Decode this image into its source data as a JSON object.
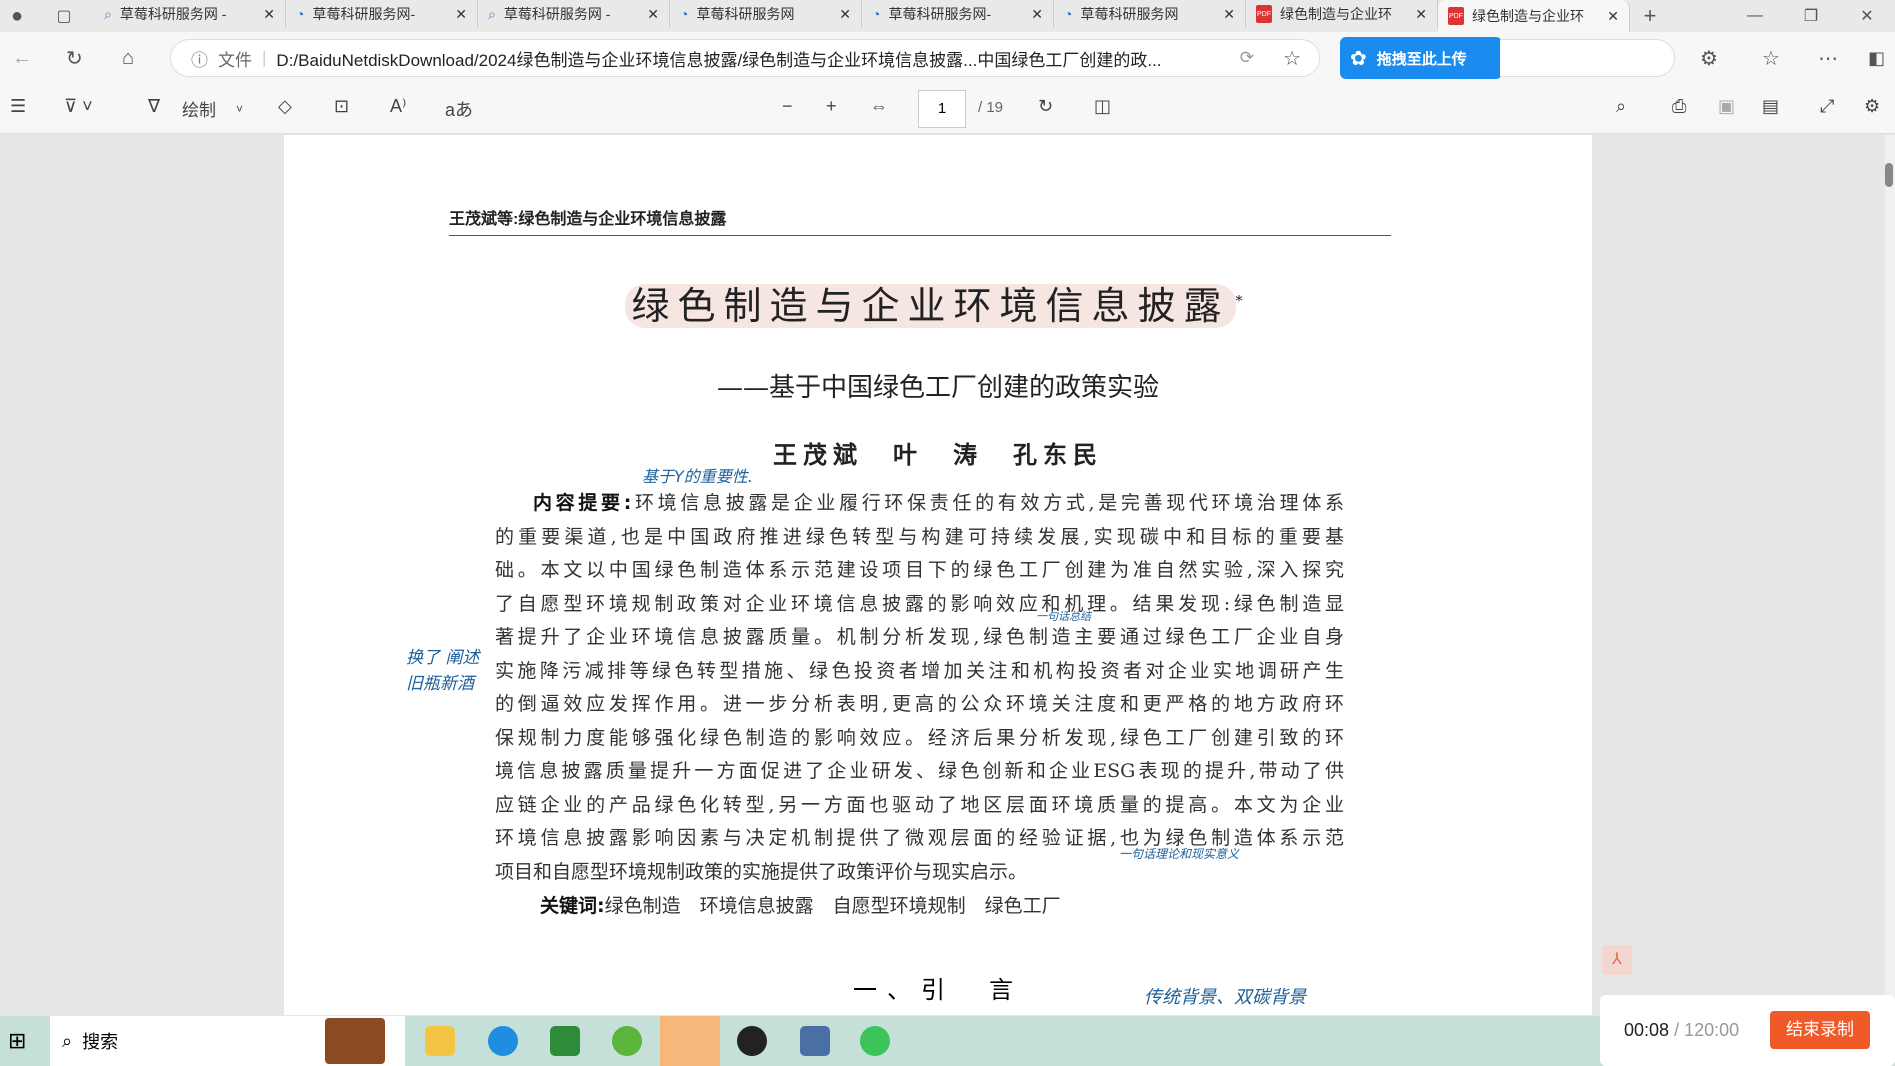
{
  "tabs": [
    {
      "label": "草莓科研服务网 -",
      "icon": "search-icon"
    },
    {
      "label": "草莓科研服务网-",
      "icon": "site-icon"
    },
    {
      "label": "草莓科研服务网 -",
      "icon": "search-icon"
    },
    {
      "label": "草莓科研服务网",
      "icon": "site-icon"
    },
    {
      "label": "草莓科研服务网-",
      "icon": "site-icon"
    },
    {
      "label": "草莓科研服务网",
      "icon": "site-icon"
    },
    {
      "label": "绿色制造与企业环",
      "icon": "pdf-icon"
    },
    {
      "label": "绿色制造与企业环",
      "icon": "pdf-icon",
      "active": true
    }
  ],
  "address": {
    "prefix": "文件",
    "url": "D:/BaiduNetdiskDownload/2024绿色制造与企业环境信息披露/绿色制造与企业环境信息披露...中国绿色工厂创建的政..."
  },
  "upload_label": "拖拽至此上传",
  "pdf_toolbar": {
    "draw_label": "绘制",
    "page": "1",
    "total": "/ 19"
  },
  "doc": {
    "running_head": "王茂斌等:绿色制造与企业环境信息披露",
    "title": "绿色制造与企业环境信息披露",
    "title_mark": "*",
    "subtitle": "——基于中国绿色工厂创建的政策实验",
    "authors": "王茂斌　叶　涛　孔东民",
    "abstract_label": "内容提要:",
    "abstract_lines": [
      "环境信息披露是企业履行环保责任的有效方式,是完善现代环境治理体系",
      "的重要渠道,也是中国政府推进绿色转型与构建可持续发展,实现碳中和目标的重要基",
      "础。本文以中国绿色制造体系示范建设项目下的绿色工厂创建为准自然实验,深入探究",
      "了自愿型环境规制政策对企业环境信息披露的影响效应和机理。结果发现:绿色制造显",
      "著提升了企业环境信息披露质量。机制分析发现,绿色制造主要通过绿色工厂企业自身",
      "实施降污减排等绿色转型措施、绿色投资者增加关注和机构投资者对企业实地调研产生",
      "的倒逼效应发挥作用。进一步分析表明,更高的公众环境关注度和更严格的地方政府环",
      "保规制力度能够强化绿色制造的影响效应。经济后果分析发现,绿色工厂创建引致的环",
      "境信息披露质量提升一方面促进了企业研发、绿色创新和企业ESG表现的提升,带动了供",
      "应链企业的产品绿色化转型,另一方面也驱动了地区层面环境质量的提高。本文为企业",
      "环境信息披露影响因素与决定机制提供了微观层面的经验证据,也为绿色制造体系示范",
      "项目和自愿型环境规制政策的实施提供了政策评价与现实启示。"
    ],
    "keywords_label": "关键词:",
    "keywords": "绿色制造　环境信息披露　自愿型环境规制　绿色工厂",
    "section": "一、引　言"
  },
  "annotations": [
    "基于Y的重要性.",
    "一句话总结",
    "换了 阐述 旧瓶新酒",
    "一句话理论和现实意义",
    "传统背景、双碳背景"
  ],
  "taskbar": {
    "search_label": "搜索"
  },
  "recorder": {
    "time": "00:08",
    "total": "/ 120:00",
    "stop_label": "结束录制"
  }
}
